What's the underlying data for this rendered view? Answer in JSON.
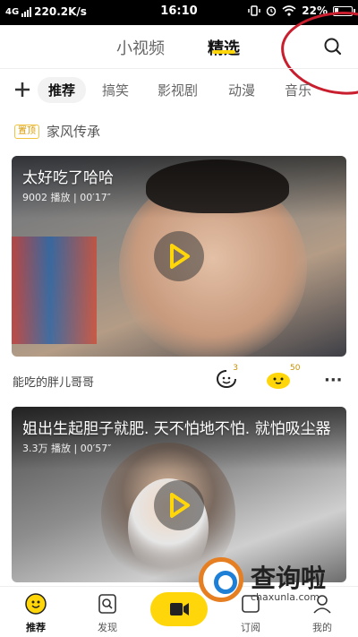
{
  "status_bar": {
    "network": "4G",
    "speed": "220.2K/s",
    "time": "16:10",
    "battery": "22%"
  },
  "header": {
    "tabs": [
      {
        "label": "小视频",
        "active": false
      },
      {
        "label": "精选",
        "active": true
      }
    ],
    "search_icon": "search-icon",
    "accent_color": "#ffd60a"
  },
  "categories": {
    "add_icon": "plus-icon",
    "items": [
      "推荐",
      "搞笑",
      "影视剧",
      "动漫",
      "音乐"
    ],
    "selected": "推荐"
  },
  "pinned": {
    "badge": "置顶",
    "title": "家风传承"
  },
  "videos": [
    {
      "title": "太好吃了哈哈",
      "plays": "9002 播放",
      "duration": "00′17″",
      "author": "能吃的胖儿哥哥",
      "comment_count": "3",
      "like_count": "50"
    },
    {
      "title": "姐出生起胆子就肥. 天不怕地不怕. 就怕吸尘器",
      "plays": "3.3万 播放",
      "duration": "00′57″"
    }
  ],
  "bottom_nav": [
    {
      "label": "推荐",
      "icon": "home-face-icon",
      "active": true
    },
    {
      "label": "发现",
      "icon": "discover-icon",
      "active": false
    },
    {
      "label": "",
      "icon": "record-video-icon",
      "active": false
    },
    {
      "label": "订阅",
      "icon": "subscribe-icon",
      "active": false
    },
    {
      "label": "我的",
      "icon": "profile-icon",
      "active": false
    }
  ],
  "watermark": {
    "text": "查询啦",
    "url": "chaxunla.com"
  }
}
